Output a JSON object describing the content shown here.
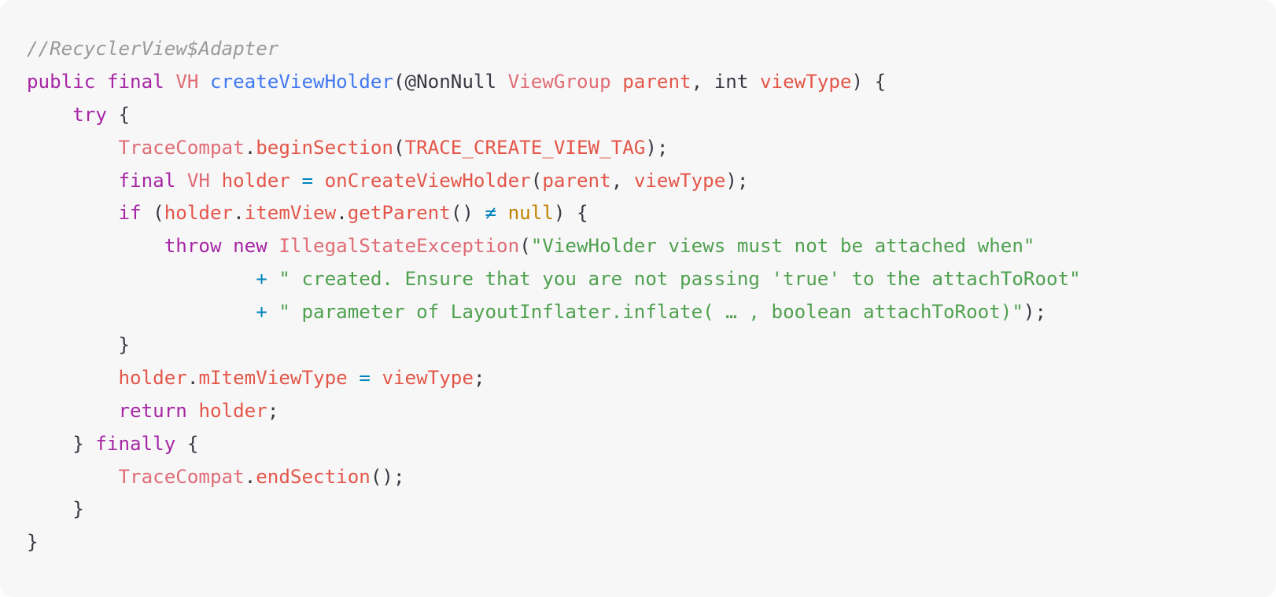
{
  "code": {
    "comment": "//RecyclerView$Adapter",
    "l2": {
      "public": "public",
      "final": "final",
      "vh": "VH",
      "fn": "createViewHolder",
      "open": "(@NonNull ",
      "vgtype": "ViewGroup",
      "parent": "parent",
      "comma_int": ", int ",
      "viewType": "viewType",
      "close": ") {"
    },
    "l3": {
      "try": "try",
      "brace": " {"
    },
    "l4": {
      "cls": "TraceCompat",
      "dot": ".",
      "method": "beginSection",
      "open": "(",
      "const": "TRACE_CREATE_VIEW_TAG",
      "end": ");"
    },
    "l5": {
      "final": "final",
      "vh": "VH",
      "holder": "holder",
      "eq": "=",
      "method": "onCreateViewHolder",
      "open": "(",
      "parent": "parent",
      "comma": ", ",
      "viewType": "viewType",
      "end": ");"
    },
    "l6": {
      "if": "if",
      "open": " (",
      "holder": "holder",
      "dot1": ".",
      "itemView": "itemView",
      "dot2": ".",
      "getParent": "getParent",
      "parens": "() ",
      "neq": "≠",
      "null": "null",
      "end": ") {"
    },
    "l7": {
      "throw": "throw",
      "new": "new",
      "cls": "IllegalStateException",
      "open": "(",
      "str": "\"ViewHolder views must not be attached when\""
    },
    "l8": {
      "plus": "+",
      "str": "\" created. Ensure that you are not passing 'true' to the attachToRoot\""
    },
    "l9": {
      "plus": "+",
      "str": "\" parameter of LayoutInflater.inflate( … , boolean attachToRoot)\"",
      "end": ");"
    },
    "l10": {
      "brace": "}"
    },
    "l11": {
      "holder": "holder",
      "dot": ".",
      "field": "mItemViewType",
      "eq": "=",
      "viewType": "viewType",
      "end": ";"
    },
    "l12": {
      "return": "return",
      "holder": "holder",
      "end": ";"
    },
    "l13": {
      "brace": "} ",
      "finally": "finally",
      "open": " {"
    },
    "l14": {
      "cls": "TraceCompat",
      "dot": ".",
      "method": "endSection",
      "end": "();"
    },
    "l15": {
      "brace": "}"
    },
    "l16": {
      "brace": "}"
    }
  }
}
